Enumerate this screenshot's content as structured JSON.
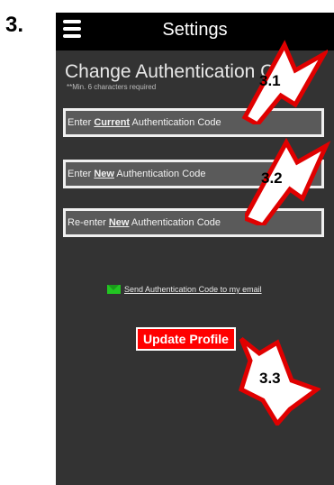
{
  "step_number": "3.",
  "header": {
    "title": "Settings"
  },
  "section": {
    "title": "Change Authentication Code",
    "note": "**Min. 6 characters required"
  },
  "fields": [
    {
      "before": "Enter ",
      "emphasis": "Current",
      "after": " Authentication Code"
    },
    {
      "before": "Enter ",
      "emphasis": "New",
      "after": " Authentication Code"
    },
    {
      "before": "Re-enter ",
      "emphasis": "New",
      "after": " Authentication Code"
    }
  ],
  "email_link": {
    "label": "Send Authentication Code to my email",
    "icon": "envelope-icon",
    "icon_color": "#22c522"
  },
  "update_button": {
    "label": "Update Profile",
    "color": "#ff0000"
  },
  "callouts": [
    {
      "label": "3.1",
      "icon": "arrow-icon",
      "color": "#e00000"
    },
    {
      "label": "3.2",
      "icon": "arrow-icon",
      "color": "#e00000"
    },
    {
      "label": "3.3",
      "icon": "arrow-icon",
      "color": "#e00000"
    }
  ]
}
